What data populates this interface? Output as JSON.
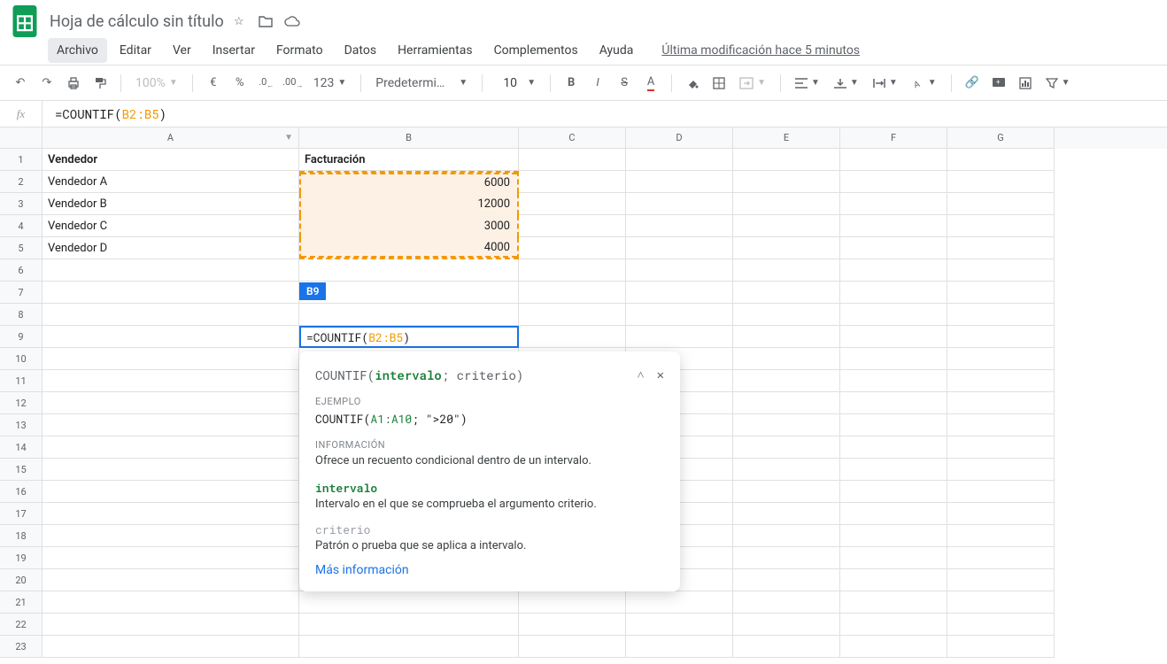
{
  "doc": {
    "title": "Hoja de cálculo sin título"
  },
  "menubar": {
    "items": [
      "Archivo",
      "Editar",
      "Ver",
      "Insertar",
      "Formato",
      "Datos",
      "Herramientas",
      "Complementos",
      "Ayuda"
    ],
    "last_edit": "Última modificación hace 5 minutos"
  },
  "toolbar": {
    "zoom": "100%",
    "currency": "€",
    "percent": "%",
    "dec_less": ".0",
    "dec_more": ".00",
    "num_format": "123",
    "font_name": "Predetermi…",
    "font_size": "10"
  },
  "formula_bar": {
    "fx": "fx",
    "prefix": "=COUNTIF(",
    "range": "B2:B5",
    "suffix": ")"
  },
  "columns": [
    "A",
    "B",
    "C",
    "D",
    "E",
    "F",
    "G"
  ],
  "sheet": {
    "headers": {
      "A": "Vendedor",
      "B": "Facturación"
    },
    "rows": [
      {
        "A": "Vendedor A",
        "B": "6000"
      },
      {
        "A": "Vendedor B",
        "B": "12000"
      },
      {
        "A": "Vendedor C",
        "B": "3000"
      },
      {
        "A": "Vendedor D",
        "B": "4000"
      }
    ]
  },
  "active": {
    "ref": "B9",
    "prefix": "=COUNTIF(",
    "range": "B2:B5",
    "suffix": ")"
  },
  "help": {
    "sigPrefix": "COUNTIF(",
    "sigArg1": "intervalo",
    "sigMiddle": "; criterio)",
    "ejemplo_label": "EJEMPLO",
    "ejemplo_prefix": "COUNTIF(",
    "ejemplo_range": "A1:A10",
    "ejemplo_suffix": "; \">20\")",
    "info_label": "INFORMACIÓN",
    "info_text": "Ofrece un recuento condicional dentro de un intervalo.",
    "arg1_name": "intervalo",
    "arg1_desc": "Intervalo en el que se comprueba el argumento criterio.",
    "arg2_name": "criterio",
    "arg2_desc": "Patrón o prueba que se aplica a intervalo.",
    "more": "Más información"
  }
}
